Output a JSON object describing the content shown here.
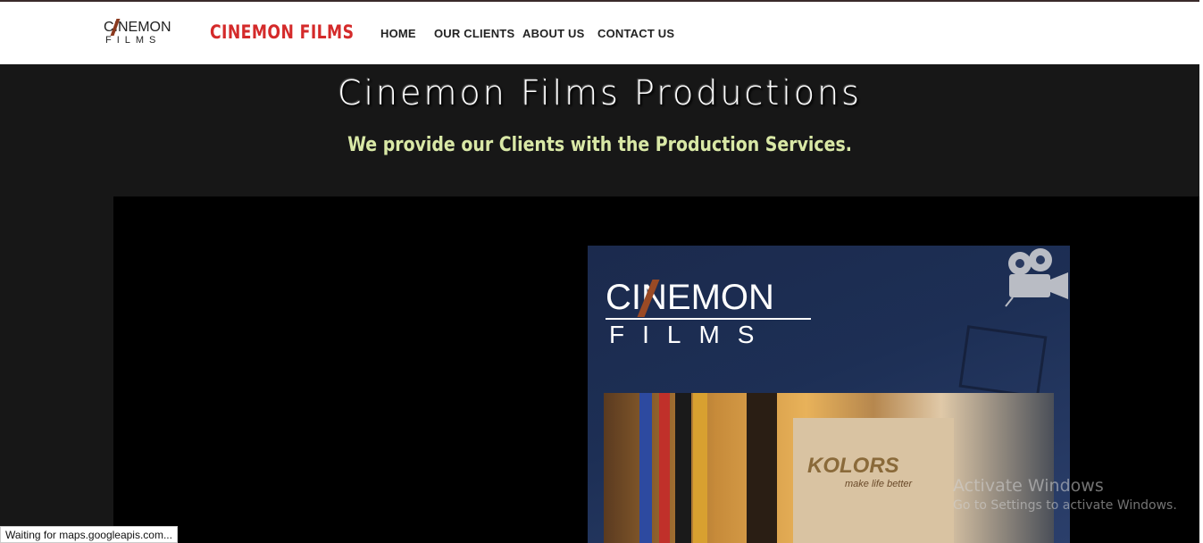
{
  "header": {
    "logo_top": "CINEMON",
    "logo_bottom": "FILMS",
    "brand": "CINEMON FILMS",
    "nav": [
      "HOME",
      "OUR CLIENTS",
      "ABOUT US",
      "CONTACT US"
    ]
  },
  "hero": {
    "title": "Cinemon Films Productions",
    "subtitle": "We provide our Clients with the Production Services."
  },
  "video": {
    "logo_top": "CINEMON",
    "logo_bottom": "FILMS",
    "sign_text": "KOLORS",
    "sign_sub": "make life better"
  },
  "watermark": {
    "title": "Activate Windows",
    "subtitle": "Go to Settings to activate Windows."
  },
  "status_bar": "Waiting for maps.googleapis.com..."
}
